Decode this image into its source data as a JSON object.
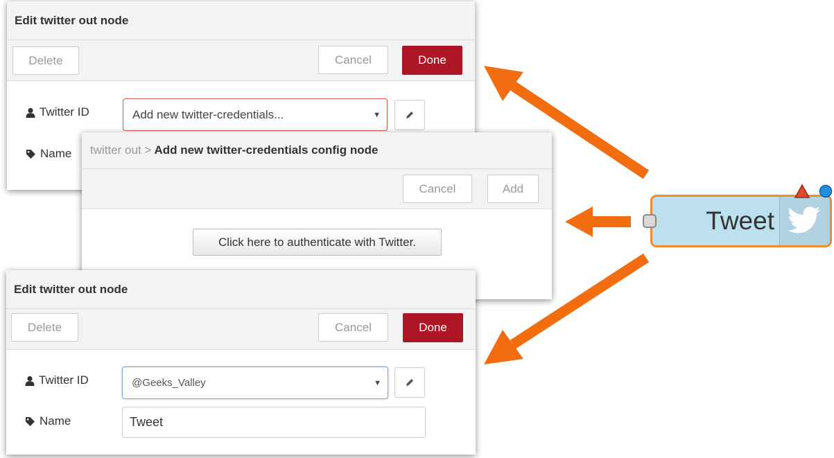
{
  "dialog_top": {
    "title": "Edit twitter out node",
    "delete_label": "Delete",
    "cancel_label": "Cancel",
    "done_label": "Done",
    "twitter_id_label": "Twitter ID",
    "twitter_id_value": "Add new twitter-credentials...",
    "name_label": "Name"
  },
  "dialog_config": {
    "breadcrumb_parent": "twitter out >",
    "title": "Add new twitter-credentials config node",
    "cancel_label": "Cancel",
    "add_label": "Add",
    "auth_button_label": "Click here to authenticate with Twitter."
  },
  "dialog_bottom": {
    "title": "Edit twitter out node",
    "delete_label": "Delete",
    "cancel_label": "Cancel",
    "done_label": "Done",
    "twitter_id_label": "Twitter ID",
    "twitter_id_value": "@Geeks_Valley",
    "name_label": "Name",
    "name_value": "Tweet"
  },
  "node": {
    "label": "Tweet",
    "icon": "twitter-bird-icon",
    "fill_color": "#bde0ee",
    "border_color": "#f08a2c",
    "warning_color": "#e0472b",
    "changed_dot_color": "#1f8fe0"
  },
  "colors": {
    "primary": "#ad1625",
    "arrow": "#f26d10",
    "error_border": "#d9534f",
    "focus_border": "#7fa4d4"
  }
}
